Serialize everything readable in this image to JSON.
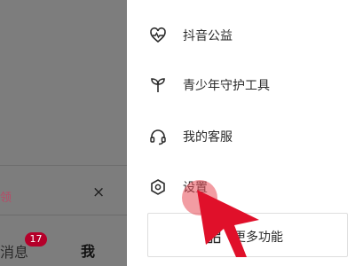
{
  "left_panel": {
    "notice_text": "领",
    "close_symbol": "×",
    "tabs": {
      "messages_label": "消息",
      "messages_badge": "17",
      "me_label": "我"
    }
  },
  "drawer": {
    "items": [
      {
        "label": "抖音公益",
        "icon": "heart-pulse-icon"
      },
      {
        "label": "青少年守护工具",
        "icon": "sprout-icon"
      },
      {
        "label": "我的客服",
        "icon": "headset-icon"
      },
      {
        "label": "设置",
        "icon": "hexagon-settings-icon"
      }
    ],
    "more_button": {
      "label": "更多功能",
      "icon": "grid-icon"
    }
  },
  "overlay": {
    "tap_indicator": "tap-highlight",
    "pointer": "red-arrow-pointer"
  },
  "colors": {
    "dim_overlay": "#7d7d7d",
    "badge": "#b5002a",
    "tap_highlight": "#e84a56",
    "pointer": "#e0102a"
  }
}
